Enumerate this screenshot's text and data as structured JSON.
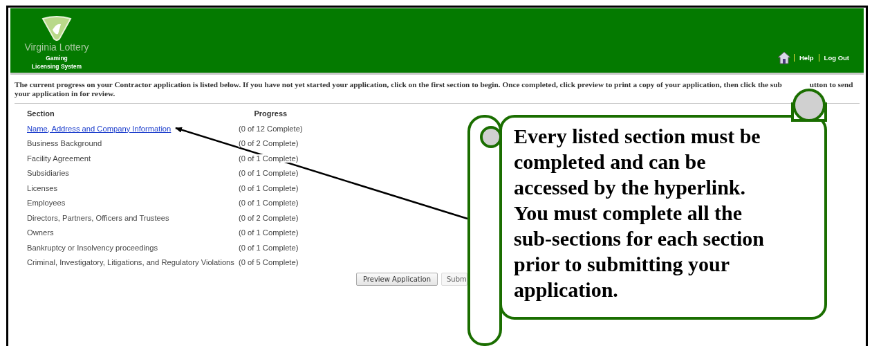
{
  "header": {
    "logo_text": "Virginia Lottery",
    "subtitle_lines": [
      "Gaming",
      "Licensing System"
    ],
    "links": [
      {
        "label": "Help"
      },
      {
        "label": "Log Out"
      }
    ]
  },
  "intro": {
    "visible_before": "The current progress on your Contractor application is listed below. If you have not yet started your application, click on the first section to begin. Once completed, click preview to print a copy of your application, then click the sub",
    "visible_after": "utton to send your application in for review."
  },
  "table": {
    "columns": [
      "Section",
      "Progress"
    ],
    "rows": [
      {
        "section": "Name, Address and Company Information",
        "link": true,
        "progress": "(0 of 12 Complete)"
      },
      {
        "section": "Business Background",
        "link": false,
        "progress": "(0 of 2 Complete)"
      },
      {
        "section": "Facility Agreement",
        "link": false,
        "progress": "(0 of 1 Complete)"
      },
      {
        "section": "Subsidiaries",
        "link": false,
        "progress": "(0 of 1 Complete)"
      },
      {
        "section": "Licenses",
        "link": false,
        "progress": "(0 of 1 Complete)"
      },
      {
        "section": "Employees",
        "link": false,
        "progress": "(0 of 1 Complete)"
      },
      {
        "section": "Directors, Partners, Officers and Trustees",
        "link": false,
        "progress": "(0 of 2 Complete)"
      },
      {
        "section": "Owners",
        "link": false,
        "progress": "(0 of 1 Complete)"
      },
      {
        "section": "Bankruptcy or Insolvency proceedings",
        "link": false,
        "progress": "(0 of 1 Complete)"
      },
      {
        "section": "Criminal, Investigatory, Litigations, and Regulatory Violations",
        "link": false,
        "progress": "(0 of 5 Complete)"
      }
    ]
  },
  "buttons": [
    {
      "label": "Preview Application",
      "disabled": false
    },
    {
      "label": "Subm",
      "disabled": true
    }
  ],
  "callout": {
    "text": "Every listed section must be completed and can be accessed by the hyperlink. You must complete all the sub-sections for each section prior to submitting your application."
  }
}
